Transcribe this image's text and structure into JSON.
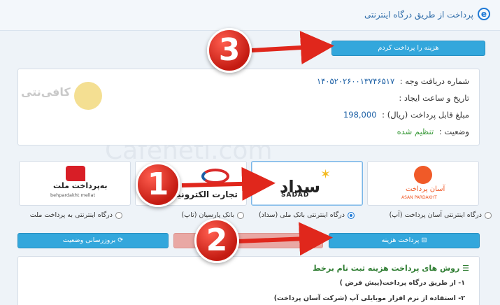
{
  "header": {
    "title": "پرداخت از طریق درگاه اینترنتی",
    "icon": "ie-icon"
  },
  "confirm_button": "هزینه را پرداخت کردم",
  "info": {
    "receipt_label": "شماره دریافت وجه :",
    "receipt_value": "۱۴۰۵۲۰۲۶۰۰۱۳۷۴۶۵۱۷",
    "created_label": "تاریخ و ساعت ایجاد :",
    "amount_label": "مبلغ قابل پرداخت (ریال) :",
    "amount_value": "198,000",
    "status_label": "وضعیت :",
    "status_value": "تنظیم شده"
  },
  "watermark": {
    "brand": "کافی‌نتی",
    "site": "Cafeneti.com"
  },
  "gateways": [
    {
      "label": "درگاه اینترنتی آسان پرداخت (آپ)",
      "logo_fa": "آسان پرداخت",
      "logo_en": "ASAN PARDAKHT",
      "selected": false
    },
    {
      "label": "درگاه اینترنتی بانک ملی (سداد)",
      "logo_fa": "سداد",
      "logo_en": "SADAD",
      "selected": true
    },
    {
      "label": "بانک پارسیان (تاپ)",
      "logo_fa": "تجارت الکترونیک",
      "selected": false
    },
    {
      "label": "درگاه اینترنتی به پرداخت ملت",
      "logo_fa": "به‌پرداخت ملت",
      "logo_en": "behpardakht mellat",
      "selected": false
    }
  ],
  "actions": {
    "pay": "پرداخت هزینه",
    "refresh": "بروزرسانی وضعیت"
  },
  "methods": {
    "title": "روش های پرداخت هزینه ثبت نام برخط",
    "items": [
      "۱- از طریق درگاه پرداخت(پیش فرض )",
      "۲- استفاده از نرم افزار موبایلی آپ (شرکت آسان پرداخت)"
    ]
  },
  "markers": [
    "1",
    "2",
    "3"
  ],
  "colors": {
    "accent": "#33a7dc",
    "marker": "#d42a1f",
    "status_green": "#3a9a3a"
  }
}
